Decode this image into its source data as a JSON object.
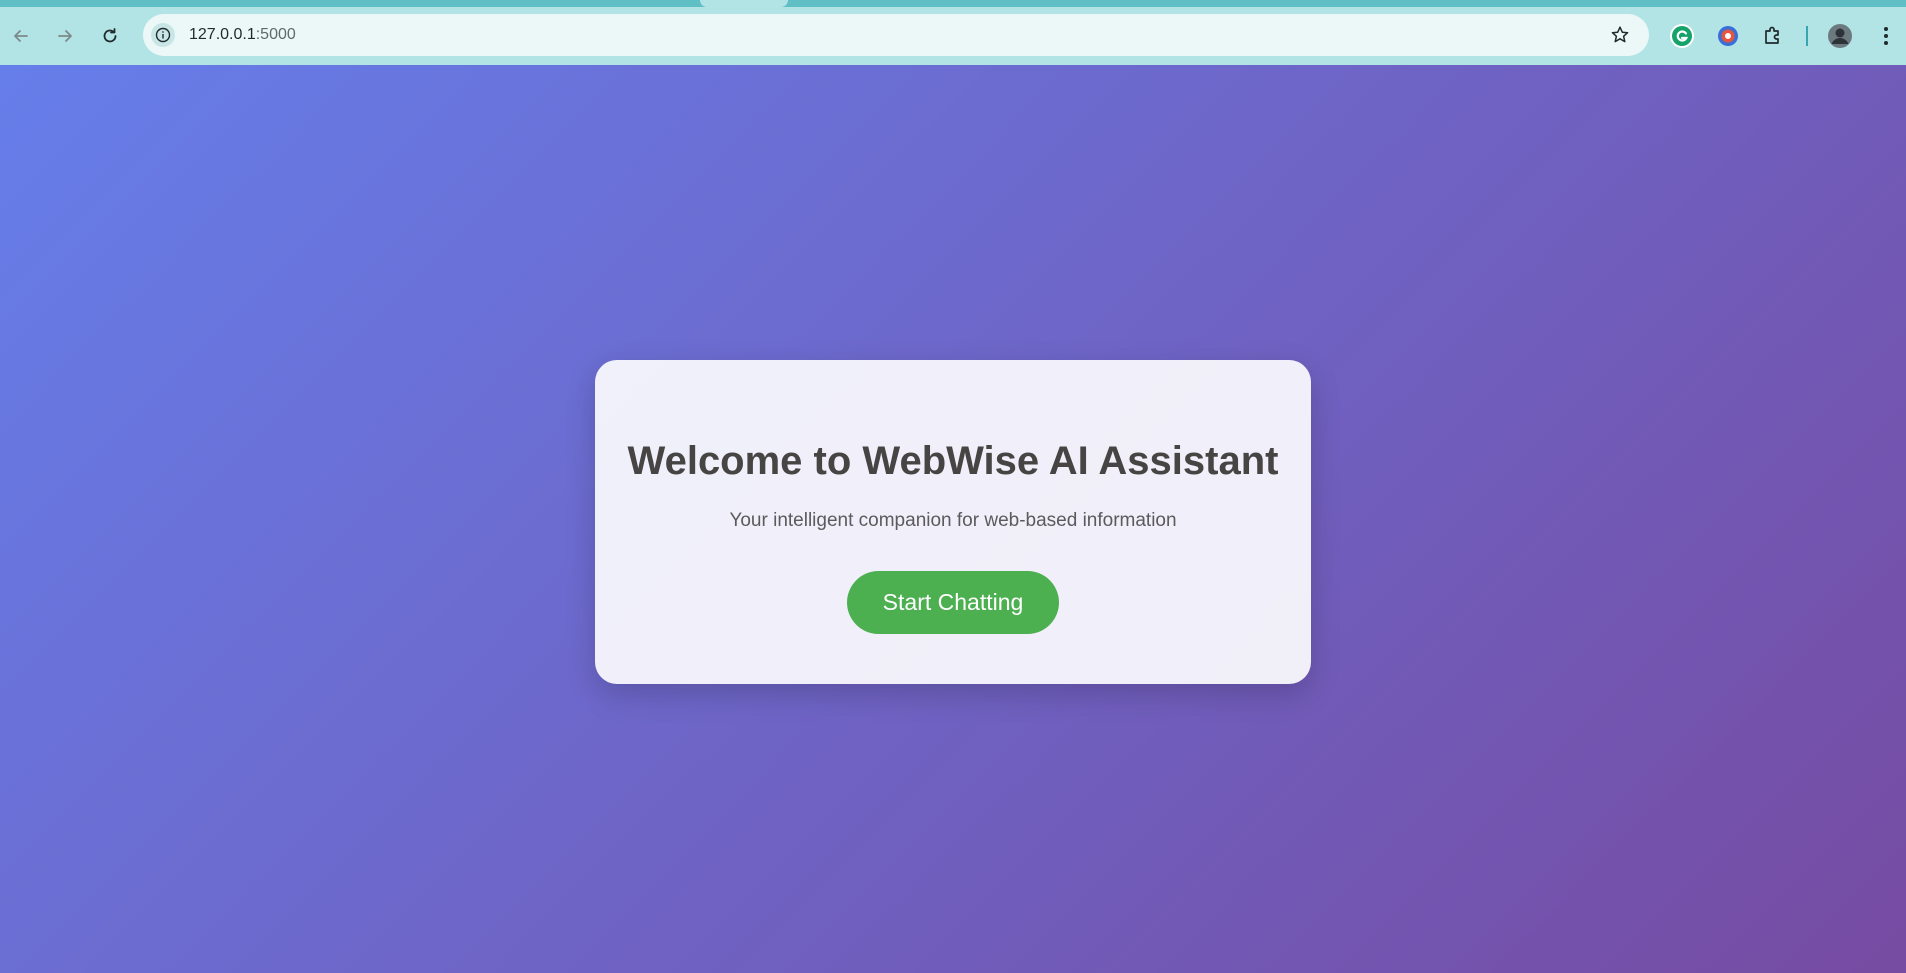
{
  "browser": {
    "url_host": "127.0.0.1",
    "url_port": ":5000",
    "accent_color": "#b2e3e5"
  },
  "icons": {
    "back": "back-arrow-icon",
    "forward": "forward-arrow-icon",
    "reload": "reload-icon",
    "site_info": "info-icon",
    "bookmark": "star-icon",
    "grammarly": "grammarly-icon",
    "extension_red": "extension-icon",
    "extensions": "puzzle-icon",
    "profile": "avatar",
    "menu": "kebab-menu-icon"
  },
  "welcome": {
    "title": "Welcome to WebWise AI Assistant",
    "subtitle": "Your intelligent companion for web-based information",
    "start_label": "Start Chatting",
    "button_color": "#4caf50",
    "gradient_start": "#667eea",
    "gradient_end": "#764ba2"
  }
}
